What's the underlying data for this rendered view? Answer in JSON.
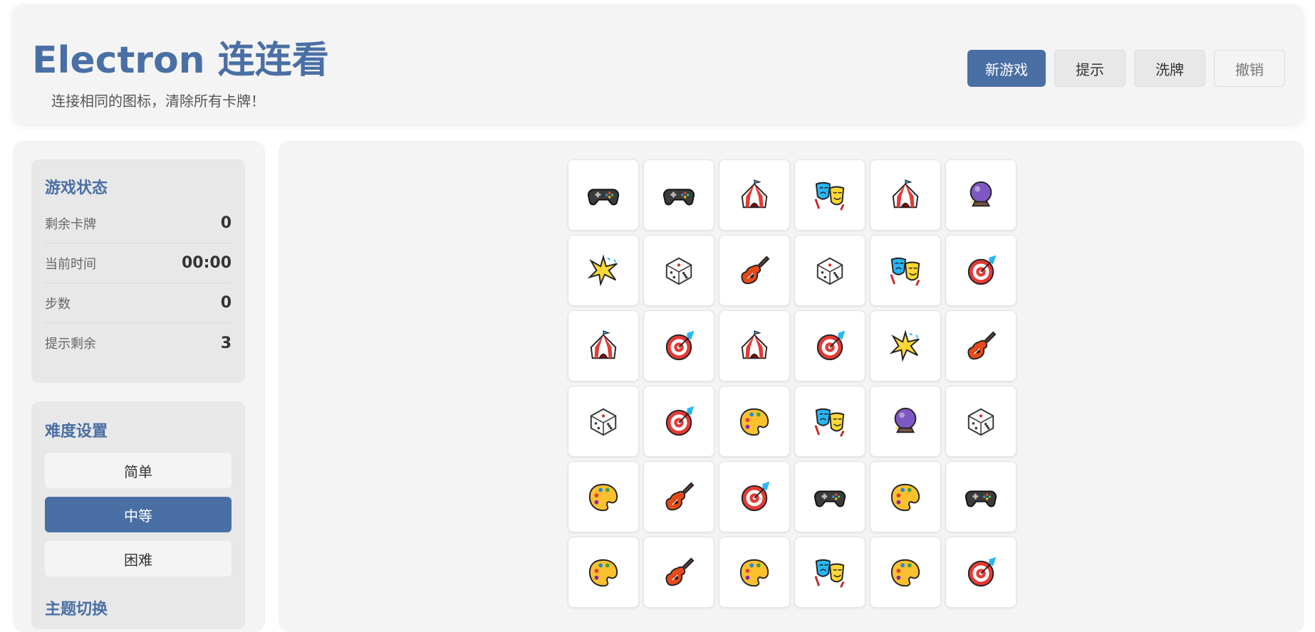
{
  "header": {
    "title": "Electron 连连看",
    "subtitle": "连接相同的图标，清除所有卡牌！",
    "buttons": {
      "new_game": "新游戏",
      "hint": "提示",
      "shuffle": "洗牌",
      "undo": "撤销"
    }
  },
  "status": {
    "title": "游戏状态",
    "remaining_label": "剩余卡牌",
    "remaining_value": "0",
    "time_label": "当前时间",
    "time_value": "00:00",
    "steps_label": "步数",
    "steps_value": "0",
    "hints_label": "提示剩余",
    "hints_value": "3"
  },
  "difficulty": {
    "title": "难度设置",
    "easy": "简单",
    "medium": "中等",
    "hard": "困难",
    "selected": "中等"
  },
  "theme": {
    "title": "主题切换"
  },
  "colors": {
    "accent": "#4a6fa5",
    "panel": "#e8e8e8",
    "card": "#f4f4f4"
  },
  "board": {
    "rows": [
      [
        "gamepad-icon",
        "gamepad-icon",
        "circus-tent-icon",
        "theater-masks-icon",
        "circus-tent-icon",
        "crystal-ball-icon"
      ],
      [
        "collision-star-icon",
        "die-icon",
        "guitar-icon",
        "die-icon",
        "theater-masks-icon",
        "dart-target-icon"
      ],
      [
        "circus-tent-icon",
        "dart-target-icon",
        "circus-tent-icon",
        "dart-target-icon",
        "collision-star-icon",
        "guitar-icon"
      ],
      [
        "die-icon",
        "dart-target-icon",
        "palette-icon",
        "theater-masks-icon",
        "crystal-ball-icon",
        "die-icon"
      ],
      [
        "palette-icon",
        "guitar-icon",
        "dart-target-icon",
        "gamepad-icon",
        "palette-icon",
        "gamepad-icon"
      ],
      [
        "palette-icon",
        "guitar-icon",
        "palette-icon",
        "theater-masks-icon",
        "palette-icon",
        "dart-target-icon"
      ]
    ]
  }
}
